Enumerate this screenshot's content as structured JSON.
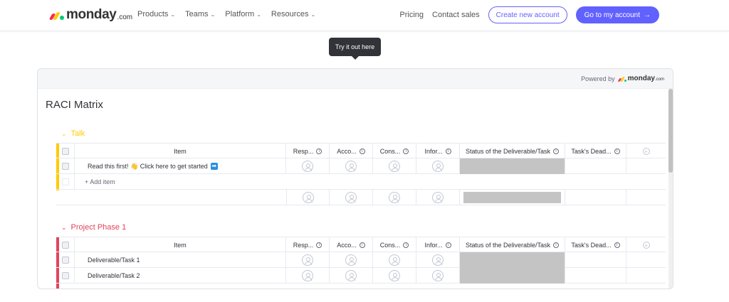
{
  "nav": {
    "logo_word": "monday",
    "logo_suffix": ".com",
    "links": [
      "Products",
      "Teams",
      "Platform",
      "Resources"
    ],
    "pricing": "Pricing",
    "contact": "Contact sales",
    "create_account": "Create new account",
    "go_to_account": "Go to my account"
  },
  "tooltip": "Try it out here",
  "embed": {
    "powered_by": "Powered by",
    "powered_logo": "monday",
    "powered_suffix": ".com"
  },
  "board": {
    "title": "RACI Matrix",
    "columns": {
      "item": "Item",
      "resp": "Resp...",
      "acco": "Acco...",
      "cons": "Cons...",
      "info": "Infor...",
      "status": "Status of the Deliverable/Task",
      "deadline": "Task's Dead..."
    },
    "groups": [
      {
        "name": "Talk",
        "color": "#ffcb00",
        "rows": [
          {
            "item": "Read this first! 👋 Click here to get started",
            "emoji": "➡"
          }
        ],
        "add_item": "+ Add item"
      },
      {
        "name": "Project Phase 1",
        "color": "#e2445c",
        "rows": [
          {
            "item": "Deliverable/Task 1"
          },
          {
            "item": "Deliverable/Task 2"
          }
        ]
      }
    ]
  },
  "colors": {
    "accent": "#6161ff",
    "status_empty": "#c4c4c4"
  }
}
